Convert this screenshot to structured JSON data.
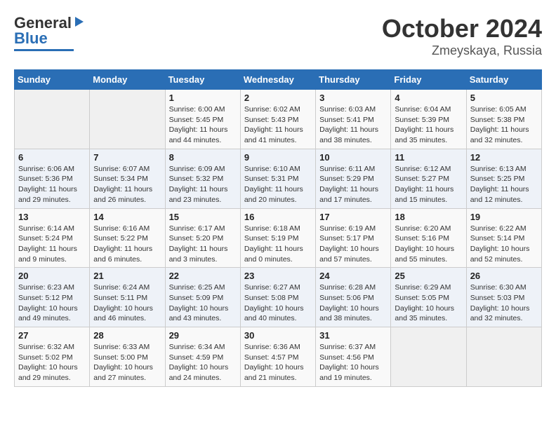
{
  "header": {
    "logo": {
      "general": "General",
      "blue": "Blue"
    },
    "month": "October 2024",
    "location": "Zmeyskaya, Russia"
  },
  "weekdays": [
    "Sunday",
    "Monday",
    "Tuesday",
    "Wednesday",
    "Thursday",
    "Friday",
    "Saturday"
  ],
  "weeks": [
    [
      {
        "day": "",
        "info": ""
      },
      {
        "day": "",
        "info": ""
      },
      {
        "day": "1",
        "info": "Sunrise: 6:00 AM\nSunset: 5:45 PM\nDaylight: 11 hours and 44 minutes."
      },
      {
        "day": "2",
        "info": "Sunrise: 6:02 AM\nSunset: 5:43 PM\nDaylight: 11 hours and 41 minutes."
      },
      {
        "day": "3",
        "info": "Sunrise: 6:03 AM\nSunset: 5:41 PM\nDaylight: 11 hours and 38 minutes."
      },
      {
        "day": "4",
        "info": "Sunrise: 6:04 AM\nSunset: 5:39 PM\nDaylight: 11 hours and 35 minutes."
      },
      {
        "day": "5",
        "info": "Sunrise: 6:05 AM\nSunset: 5:38 PM\nDaylight: 11 hours and 32 minutes."
      }
    ],
    [
      {
        "day": "6",
        "info": "Sunrise: 6:06 AM\nSunset: 5:36 PM\nDaylight: 11 hours and 29 minutes."
      },
      {
        "day": "7",
        "info": "Sunrise: 6:07 AM\nSunset: 5:34 PM\nDaylight: 11 hours and 26 minutes."
      },
      {
        "day": "8",
        "info": "Sunrise: 6:09 AM\nSunset: 5:32 PM\nDaylight: 11 hours and 23 minutes."
      },
      {
        "day": "9",
        "info": "Sunrise: 6:10 AM\nSunset: 5:31 PM\nDaylight: 11 hours and 20 minutes."
      },
      {
        "day": "10",
        "info": "Sunrise: 6:11 AM\nSunset: 5:29 PM\nDaylight: 11 hours and 17 minutes."
      },
      {
        "day": "11",
        "info": "Sunrise: 6:12 AM\nSunset: 5:27 PM\nDaylight: 11 hours and 15 minutes."
      },
      {
        "day": "12",
        "info": "Sunrise: 6:13 AM\nSunset: 5:25 PM\nDaylight: 11 hours and 12 minutes."
      }
    ],
    [
      {
        "day": "13",
        "info": "Sunrise: 6:14 AM\nSunset: 5:24 PM\nDaylight: 11 hours and 9 minutes."
      },
      {
        "day": "14",
        "info": "Sunrise: 6:16 AM\nSunset: 5:22 PM\nDaylight: 11 hours and 6 minutes."
      },
      {
        "day": "15",
        "info": "Sunrise: 6:17 AM\nSunset: 5:20 PM\nDaylight: 11 hours and 3 minutes."
      },
      {
        "day": "16",
        "info": "Sunrise: 6:18 AM\nSunset: 5:19 PM\nDaylight: 11 hours and 0 minutes."
      },
      {
        "day": "17",
        "info": "Sunrise: 6:19 AM\nSunset: 5:17 PM\nDaylight: 10 hours and 57 minutes."
      },
      {
        "day": "18",
        "info": "Sunrise: 6:20 AM\nSunset: 5:16 PM\nDaylight: 10 hours and 55 minutes."
      },
      {
        "day": "19",
        "info": "Sunrise: 6:22 AM\nSunset: 5:14 PM\nDaylight: 10 hours and 52 minutes."
      }
    ],
    [
      {
        "day": "20",
        "info": "Sunrise: 6:23 AM\nSunset: 5:12 PM\nDaylight: 10 hours and 49 minutes."
      },
      {
        "day": "21",
        "info": "Sunrise: 6:24 AM\nSunset: 5:11 PM\nDaylight: 10 hours and 46 minutes."
      },
      {
        "day": "22",
        "info": "Sunrise: 6:25 AM\nSunset: 5:09 PM\nDaylight: 10 hours and 43 minutes."
      },
      {
        "day": "23",
        "info": "Sunrise: 6:27 AM\nSunset: 5:08 PM\nDaylight: 10 hours and 40 minutes."
      },
      {
        "day": "24",
        "info": "Sunrise: 6:28 AM\nSunset: 5:06 PM\nDaylight: 10 hours and 38 minutes."
      },
      {
        "day": "25",
        "info": "Sunrise: 6:29 AM\nSunset: 5:05 PM\nDaylight: 10 hours and 35 minutes."
      },
      {
        "day": "26",
        "info": "Sunrise: 6:30 AM\nSunset: 5:03 PM\nDaylight: 10 hours and 32 minutes."
      }
    ],
    [
      {
        "day": "27",
        "info": "Sunrise: 6:32 AM\nSunset: 5:02 PM\nDaylight: 10 hours and 29 minutes."
      },
      {
        "day": "28",
        "info": "Sunrise: 6:33 AM\nSunset: 5:00 PM\nDaylight: 10 hours and 27 minutes."
      },
      {
        "day": "29",
        "info": "Sunrise: 6:34 AM\nSunset: 4:59 PM\nDaylight: 10 hours and 24 minutes."
      },
      {
        "day": "30",
        "info": "Sunrise: 6:36 AM\nSunset: 4:57 PM\nDaylight: 10 hours and 21 minutes."
      },
      {
        "day": "31",
        "info": "Sunrise: 6:37 AM\nSunset: 4:56 PM\nDaylight: 10 hours and 19 minutes."
      },
      {
        "day": "",
        "info": ""
      },
      {
        "day": "",
        "info": ""
      }
    ]
  ]
}
